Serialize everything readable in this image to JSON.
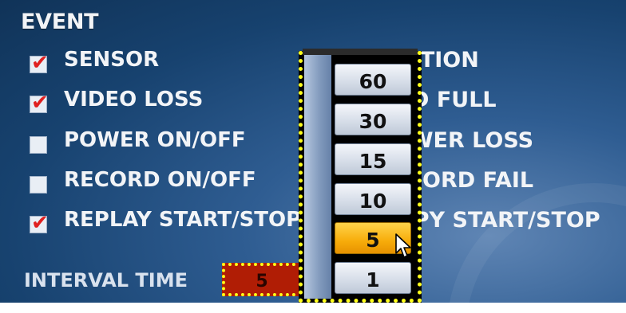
{
  "title": "EVENT",
  "left_events": [
    {
      "label": "SENSOR",
      "checked": true
    },
    {
      "label": "VIDEO LOSS",
      "checked": true
    },
    {
      "label": "POWER ON/OFF",
      "checked": false
    },
    {
      "label": "RECORD ON/OFF",
      "checked": false
    },
    {
      "label": "REPLAY START/STOP",
      "checked": true
    }
  ],
  "right_events": [
    {
      "label": "MOTION"
    },
    {
      "label": "HDD FULL"
    },
    {
      "label": "POWER LOSS"
    },
    {
      "label": "RECORD FAIL"
    },
    {
      "label": "COPY START/STOP"
    }
  ],
  "interval": {
    "label": "INTERVAL TIME",
    "value": "5"
  },
  "dropdown": {
    "options": [
      "60",
      "30",
      "15",
      "10",
      "5",
      "1"
    ],
    "selected": "5"
  },
  "colors": {
    "highlight_border": "#ffff1a",
    "selected_option": "#f7ac0a",
    "interval_box": "#b01d05",
    "checkmark": "#e02020"
  }
}
